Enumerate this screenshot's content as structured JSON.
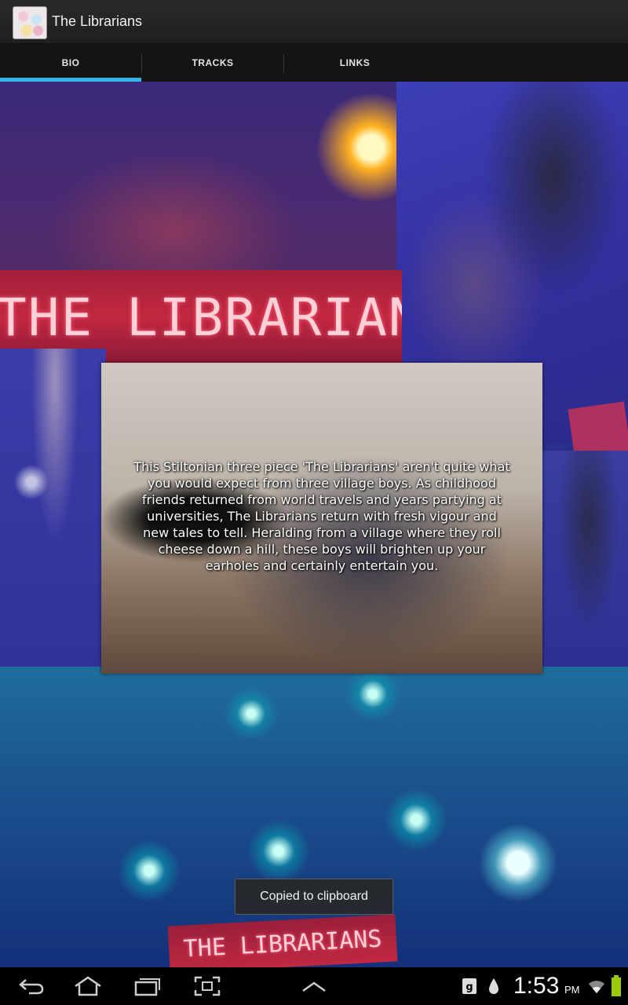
{
  "app": {
    "title": "The Librarians",
    "icon": "album-art-icon"
  },
  "tabs": [
    {
      "label": "BIO",
      "selected": true
    },
    {
      "label": "TRACKS",
      "selected": false
    },
    {
      "label": "LINKS",
      "selected": false
    }
  ],
  "accent_color": "#33b5e5",
  "collage": {
    "banner_text": "THE LIBRARIANS",
    "bottom_banner_text": "THE LIBRARIANS"
  },
  "bio": {
    "text": "This Stiltonian three piece 'The Librarians' aren't quite what you would expect from three village boys. As childhood friends returned from world travels and years partying at universities, The Librarians return with fresh vigour and new tales to tell. Heralding from a village where they roll cheese down a hill, these boys will brighten up your earholes and certainly entertain you."
  },
  "toast": {
    "message": "Copied to clipboard"
  },
  "system_bar": {
    "buttons": [
      "back-icon",
      "home-icon",
      "recent-apps-icon",
      "screenshot-icon",
      "menu-up-icon"
    ],
    "status_icons": [
      "notification-icon",
      "data-drop-icon",
      "wifi-icon",
      "battery-icon"
    ],
    "time": "1:53",
    "ampm": "PM"
  }
}
